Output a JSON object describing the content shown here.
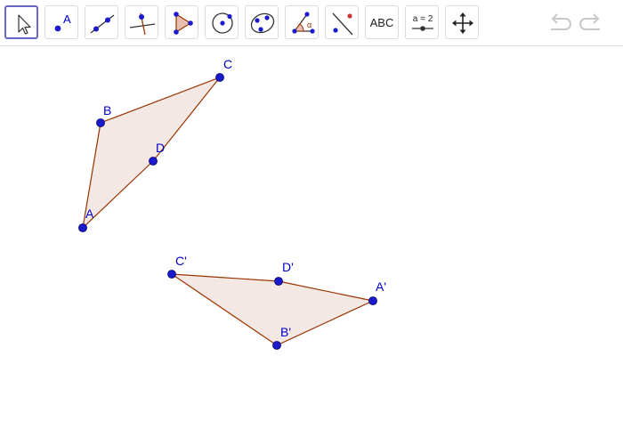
{
  "toolbar": {
    "tools": [
      {
        "name": "move",
        "icon": "pointer-arrow-icon",
        "selected": true
      },
      {
        "name": "point",
        "icon": "point-icon",
        "label": "A"
      },
      {
        "name": "line",
        "icon": "line-icon"
      },
      {
        "name": "perpendicular-line",
        "icon": "perpendicular-line-icon"
      },
      {
        "name": "polygon",
        "icon": "polygon-icon"
      },
      {
        "name": "circle-center-point",
        "icon": "circle-icon"
      },
      {
        "name": "conic-through-points",
        "icon": "ellipse-icon"
      },
      {
        "name": "angle",
        "icon": "angle-icon"
      },
      {
        "name": "reflect-about-line",
        "icon": "reflect-icon"
      },
      {
        "name": "text",
        "icon": "text-icon",
        "label": "ABC"
      },
      {
        "name": "slider",
        "icon": "slider-icon",
        "label": "a = 2"
      },
      {
        "name": "move-graphics-view",
        "icon": "move-arrows-icon"
      }
    ],
    "undo_icon": "undo-icon",
    "redo_icon": "redo-icon"
  },
  "colors": {
    "point": "#1a1acc",
    "point_label": "#0000cc",
    "edge": "#993300",
    "fill": "#f4e8e4",
    "tool_border": "#dcdcdc",
    "selected_border": "#6666cc",
    "disabled_icon": "#c8c8c8"
  },
  "points": {
    "A": {
      "label": "A"
    },
    "B": {
      "label": "B"
    },
    "C": {
      "label": "C"
    },
    "D": {
      "label": "D"
    },
    "A1": {
      "label": "A'"
    },
    "B1": {
      "label": "B'"
    },
    "C1": {
      "label": "C'"
    },
    "D1": {
      "label": "D'"
    }
  }
}
